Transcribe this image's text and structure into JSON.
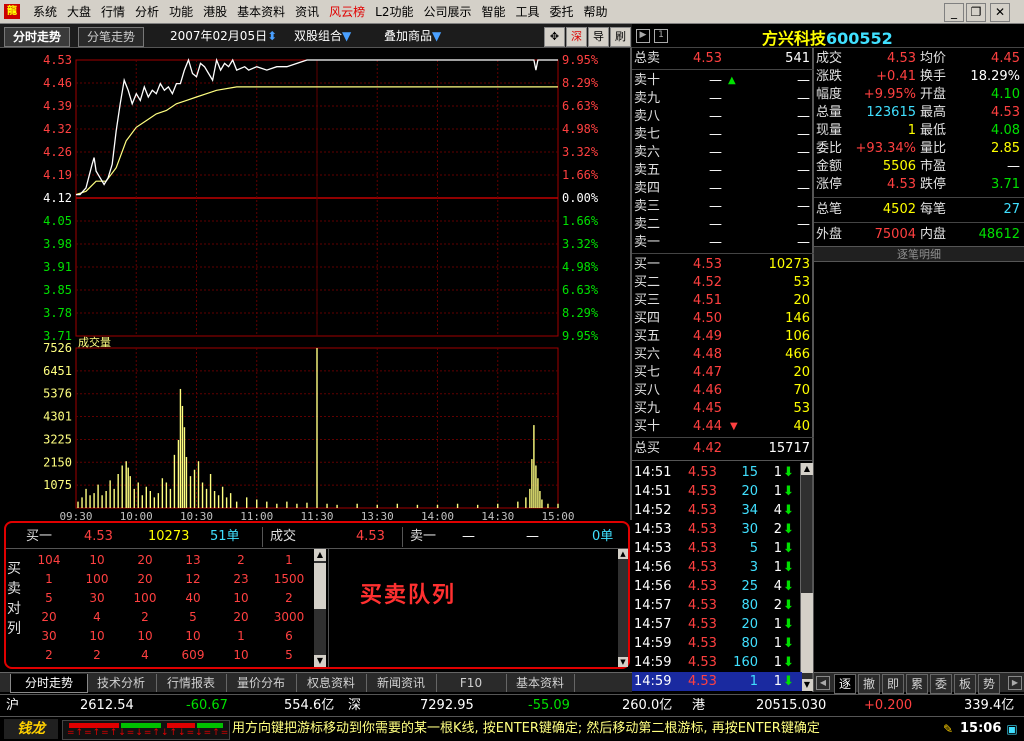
{
  "menu": {
    "items": [
      "系统",
      "大盘",
      "行情",
      "分析",
      "功能",
      "港股",
      "基本资料",
      "资讯",
      "风云榜",
      "L2功能",
      "公司展示",
      "智能",
      "工具",
      "委托",
      "帮助"
    ],
    "hot_index": 8
  },
  "tabs": {
    "t1": "分时走势",
    "t2": "分笔走势",
    "date": "2007年02月05日",
    "combo": "双股组合",
    "overlay": "叠加商品"
  },
  "tools": [
    "✥",
    "深",
    "导",
    "刷"
  ],
  "stock": {
    "name": "方兴科技",
    "code": "600552"
  },
  "chart_data": {
    "type": "line",
    "price_axis": {
      "ticks": [
        "4.53",
        "4.46",
        "4.39",
        "4.32",
        "4.26",
        "4.19",
        "4.12",
        "4.05",
        "3.98",
        "3.91",
        "3.85",
        "3.78",
        "3.71"
      ],
      "ref": 4.12,
      "min": 3.71,
      "max": 4.53
    },
    "pct_ticks": [
      "9.95%",
      "8.29%",
      "6.63%",
      "4.98%",
      "3.32%",
      "1.66%",
      "0.00%",
      "1.66%",
      "3.32%",
      "4.98%",
      "6.63%",
      "8.29%",
      "9.95%"
    ],
    "volume_label": "成交量",
    "volume_ticks": [
      "7526",
      "6451",
      "5376",
      "4301",
      "3225",
      "2150",
      "1075"
    ],
    "volume_max": 7526,
    "time_labels": [
      "09:30",
      "10:00",
      "10:30",
      "11:00",
      "11:30",
      "13:30",
      "14:00",
      "14:30",
      "15:00"
    ],
    "price_series": [
      [
        0,
        4.13
      ],
      [
        2,
        4.13
      ],
      [
        5,
        4.15
      ],
      [
        8,
        4.22
      ],
      [
        9,
        4.24
      ],
      [
        10,
        4.2
      ],
      [
        12,
        4.18
      ],
      [
        14,
        4.16
      ],
      [
        16,
        4.18
      ],
      [
        18,
        4.22
      ],
      [
        20,
        4.32
      ],
      [
        22,
        4.4
      ],
      [
        24,
        4.47
      ],
      [
        26,
        4.44
      ],
      [
        28,
        4.4
      ],
      [
        30,
        4.43
      ],
      [
        32,
        4.41
      ],
      [
        34,
        4.45
      ],
      [
        36,
        4.42
      ],
      [
        38,
        4.44
      ],
      [
        40,
        4.43
      ],
      [
        42,
        4.46
      ],
      [
        44,
        4.44
      ],
      [
        46,
        4.45
      ],
      [
        48,
        4.43
      ],
      [
        50,
        4.46
      ],
      [
        52,
        4.46
      ],
      [
        54,
        4.5
      ],
      [
        56,
        4.53
      ],
      [
        58,
        4.49
      ],
      [
        60,
        4.48
      ],
      [
        62,
        4.52
      ],
      [
        64,
        4.51
      ],
      [
        66,
        4.49
      ],
      [
        68,
        4.47
      ],
      [
        70,
        4.53
      ],
      [
        72,
        4.5
      ],
      [
        74,
        4.52
      ],
      [
        76,
        4.51
      ],
      [
        78,
        4.53
      ],
      [
        80,
        4.5
      ],
      [
        84,
        4.51
      ],
      [
        86,
        4.5
      ],
      [
        90,
        4.51
      ],
      [
        95,
        4.5
      ],
      [
        100,
        4.51
      ],
      [
        105,
        4.51
      ],
      [
        110,
        4.52
      ],
      [
        115,
        4.53
      ],
      [
        140,
        4.53
      ],
      [
        200,
        4.53
      ],
      [
        228,
        4.53
      ],
      [
        229,
        4.5
      ],
      [
        230,
        4.53
      ],
      [
        240,
        4.53
      ]
    ],
    "avg_series": [
      [
        0,
        4.13
      ],
      [
        5,
        4.14
      ],
      [
        10,
        4.17
      ],
      [
        15,
        4.17
      ],
      [
        20,
        4.21
      ],
      [
        25,
        4.29
      ],
      [
        30,
        4.33
      ],
      [
        35,
        4.35
      ],
      [
        40,
        4.37
      ],
      [
        45,
        4.38
      ],
      [
        50,
        4.4
      ],
      [
        55,
        4.41
      ],
      [
        60,
        4.42
      ],
      [
        65,
        4.43
      ],
      [
        70,
        4.44
      ],
      [
        80,
        4.45
      ],
      [
        90,
        4.45
      ],
      [
        100,
        4.45
      ],
      [
        120,
        4.45
      ],
      [
        150,
        4.45
      ],
      [
        180,
        4.45
      ],
      [
        210,
        4.45
      ],
      [
        240,
        4.45
      ]
    ],
    "volume_series": [
      [
        1,
        300
      ],
      [
        3,
        500
      ],
      [
        5,
        900
      ],
      [
        7,
        600
      ],
      [
        9,
        700
      ],
      [
        11,
        1100
      ],
      [
        13,
        600
      ],
      [
        15,
        800
      ],
      [
        17,
        1300
      ],
      [
        19,
        900
      ],
      [
        21,
        1600
      ],
      [
        23,
        2000
      ],
      [
        25,
        2200
      ],
      [
        26,
        1900
      ],
      [
        27,
        1500
      ],
      [
        29,
        900
      ],
      [
        31,
        1200
      ],
      [
        33,
        600
      ],
      [
        35,
        1000
      ],
      [
        37,
        800
      ],
      [
        39,
        500
      ],
      [
        41,
        700
      ],
      [
        43,
        1400
      ],
      [
        45,
        1200
      ],
      [
        47,
        900
      ],
      [
        49,
        2500
      ],
      [
        51,
        3200
      ],
      [
        52,
        5600
      ],
      [
        53,
        4800
      ],
      [
        54,
        3800
      ],
      [
        55,
        2400
      ],
      [
        57,
        1500
      ],
      [
        59,
        1800
      ],
      [
        61,
        2200
      ],
      [
        63,
        1200
      ],
      [
        65,
        900
      ],
      [
        67,
        1600
      ],
      [
        69,
        800
      ],
      [
        71,
        600
      ],
      [
        73,
        1000
      ],
      [
        75,
        500
      ],
      [
        77,
        700
      ],
      [
        80,
        300
      ],
      [
        85,
        500
      ],
      [
        90,
        400
      ],
      [
        95,
        300
      ],
      [
        100,
        200
      ],
      [
        105,
        300
      ],
      [
        110,
        200
      ],
      [
        115,
        250
      ],
      [
        120,
        7526
      ],
      [
        125,
        200
      ],
      [
        130,
        150
      ],
      [
        140,
        200
      ],
      [
        150,
        150
      ],
      [
        160,
        200
      ],
      [
        170,
        150
      ],
      [
        180,
        150
      ],
      [
        190,
        200
      ],
      [
        200,
        150
      ],
      [
        210,
        200
      ],
      [
        220,
        300
      ],
      [
        224,
        500
      ],
      [
        226,
        900
      ],
      [
        227,
        2300
      ],
      [
        228,
        3900
      ],
      [
        229,
        2000
      ],
      [
        230,
        1400
      ],
      [
        231,
        800
      ],
      [
        232,
        400
      ],
      [
        235,
        200
      ],
      [
        240,
        200
      ]
    ]
  },
  "quote": {
    "zongmai": {
      "label": "总卖",
      "price": "4.53",
      "vol": "541"
    },
    "sells": [
      {
        "label": "卖十",
        "price": "—",
        "vol": "—"
      },
      {
        "label": "卖九",
        "price": "—",
        "vol": "—"
      },
      {
        "label": "卖八",
        "price": "—",
        "vol": "—"
      },
      {
        "label": "卖七",
        "price": "—",
        "vol": "—"
      },
      {
        "label": "卖六",
        "price": "—",
        "vol": "—"
      },
      {
        "label": "卖五",
        "price": "—",
        "vol": "—"
      },
      {
        "label": "卖四",
        "price": "—",
        "vol": "—"
      },
      {
        "label": "卖三",
        "price": "—",
        "vol": "—"
      },
      {
        "label": "卖二",
        "price": "—",
        "vol": "—"
      },
      {
        "label": "卖一",
        "price": "—",
        "vol": "—"
      }
    ],
    "buys": [
      {
        "label": "买一",
        "price": "4.53",
        "vol": "10273"
      },
      {
        "label": "买二",
        "price": "4.52",
        "vol": "53"
      },
      {
        "label": "买三",
        "price": "4.51",
        "vol": "20"
      },
      {
        "label": "买四",
        "price": "4.50",
        "vol": "146"
      },
      {
        "label": "买五",
        "price": "4.49",
        "vol": "106"
      },
      {
        "label": "买六",
        "price": "4.48",
        "vol": "466"
      },
      {
        "label": "买七",
        "price": "4.47",
        "vol": "20"
      },
      {
        "label": "买八",
        "price": "4.46",
        "vol": "70"
      },
      {
        "label": "买九",
        "price": "4.45",
        "vol": "53"
      },
      {
        "label": "买十",
        "price": "4.44",
        "vol": "40"
      }
    ],
    "zongmai2": {
      "label": "总买",
      "price": "4.42",
      "vol": "15717"
    }
  },
  "stats": [
    {
      "l": "成交",
      "v": "4.53",
      "c": "red",
      "l2": "均价",
      "v2": "4.45",
      "c2": "red"
    },
    {
      "l": "涨跌",
      "v": "+0.41",
      "c": "red",
      "l2": "换手",
      "v2": "18.29%",
      "c2": "white"
    },
    {
      "l": "幅度",
      "v": "+9.95%",
      "c": "red",
      "l2": "开盘",
      "v2": "4.10",
      "c2": "green"
    },
    {
      "l": "总量",
      "v": "123615",
      "c": "cyan",
      "l2": "最高",
      "v2": "4.53",
      "c2": "red"
    },
    {
      "l": "现量",
      "v": "1",
      "c": "yellow",
      "l2": "最低",
      "v2": "4.08",
      "c2": "green"
    },
    {
      "l": "委比",
      "v": "+93.34%",
      "c": "red",
      "l2": "量比",
      "v2": "2.85",
      "c2": "yellow"
    },
    {
      "l": "金额",
      "v": "5506",
      "c": "yellow",
      "l2": "市盈",
      "v2": "—",
      "c2": "white"
    },
    {
      "l": "涨停",
      "v": "4.53",
      "c": "red",
      "l2": "跌停",
      "v2": "3.71",
      "c2": "green"
    }
  ],
  "zongbi": {
    "l": "总笔",
    "v": "4502",
    "l2": "每笔",
    "v2": "27"
  },
  "waipan": {
    "l": "外盘",
    "v": "75004",
    "l2": "内盘",
    "v2": "48612"
  },
  "zhubi_title": "逐笔明细",
  "trades": [
    {
      "t": "14:51",
      "p": "4.53",
      "v": "15",
      "n": "1"
    },
    {
      "t": "14:51",
      "p": "4.53",
      "v": "20",
      "n": "1"
    },
    {
      "t": "14:52",
      "p": "4.53",
      "v": "34",
      "n": "4"
    },
    {
      "t": "14:53",
      "p": "4.53",
      "v": "30",
      "n": "2"
    },
    {
      "t": "14:53",
      "p": "4.53",
      "v": "5",
      "n": "1"
    },
    {
      "t": "14:56",
      "p": "4.53",
      "v": "3",
      "n": "1"
    },
    {
      "t": "14:56",
      "p": "4.53",
      "v": "25",
      "n": "4"
    },
    {
      "t": "14:57",
      "p": "4.53",
      "v": "80",
      "n": "2"
    },
    {
      "t": "14:57",
      "p": "4.53",
      "v": "20",
      "n": "1"
    },
    {
      "t": "14:59",
      "p": "4.53",
      "v": "80",
      "n": "1"
    },
    {
      "t": "14:59",
      "p": "4.53",
      "v": "160",
      "n": "1"
    },
    {
      "t": "14:59",
      "p": "4.53",
      "v": "1",
      "n": "1"
    }
  ],
  "queue": {
    "buy1_label": "买一",
    "buy1_price": "4.53",
    "buy1_vol": "10273",
    "buy1_count": "51单",
    "deal_label": "成交",
    "deal_price": "4.53",
    "sell1_label": "卖一",
    "sell1_price": "—",
    "sell1_vol": "—",
    "sell1_count": "0单",
    "side_label": [
      "买",
      "卖",
      "对",
      "列"
    ],
    "annotation": "买卖队列",
    "grid": [
      [
        "104",
        "10",
        "20",
        "13",
        "2",
        "1"
      ],
      [
        "1",
        "100",
        "20",
        "12",
        "23",
        "1500"
      ],
      [
        "5",
        "30",
        "100",
        "40",
        "10",
        "2"
      ],
      [
        "20",
        "4",
        "2",
        "5",
        "20",
        "3000"
      ],
      [
        "30",
        "10",
        "10",
        "10",
        "1",
        "6"
      ],
      [
        "2",
        "2",
        "4",
        "609",
        "10",
        "5"
      ]
    ]
  },
  "bottom_tabs": [
    "分时走势",
    "技术分析",
    "行情报表",
    "量价分布",
    "权息资料",
    "新闻资讯",
    "F10",
    "基本资料"
  ],
  "right_tabs": [
    "逐",
    "撤",
    "即",
    "累",
    "委",
    "板",
    "势"
  ],
  "index": {
    "sh_label": "沪",
    "sh_val": "2612.54",
    "sh_chg": "-60.67",
    "sh_amt": "554.6亿",
    "sz_label": "深",
    "sz_val": "7292.95",
    "sz_chg": "-55.09",
    "sz_amt": "260.0亿",
    "hk_label": "港",
    "hk_val": "20515.030",
    "hk_chg": "+0.200",
    "hk_amt": "339.4亿"
  },
  "status": {
    "logo": "钱龙",
    "ticker": "用方向键把游标移动到你需要的某一根K线, 按ENTER键确定; 然后移动第二根游标, 再按ENTER键确定",
    "clock": "15:06"
  }
}
